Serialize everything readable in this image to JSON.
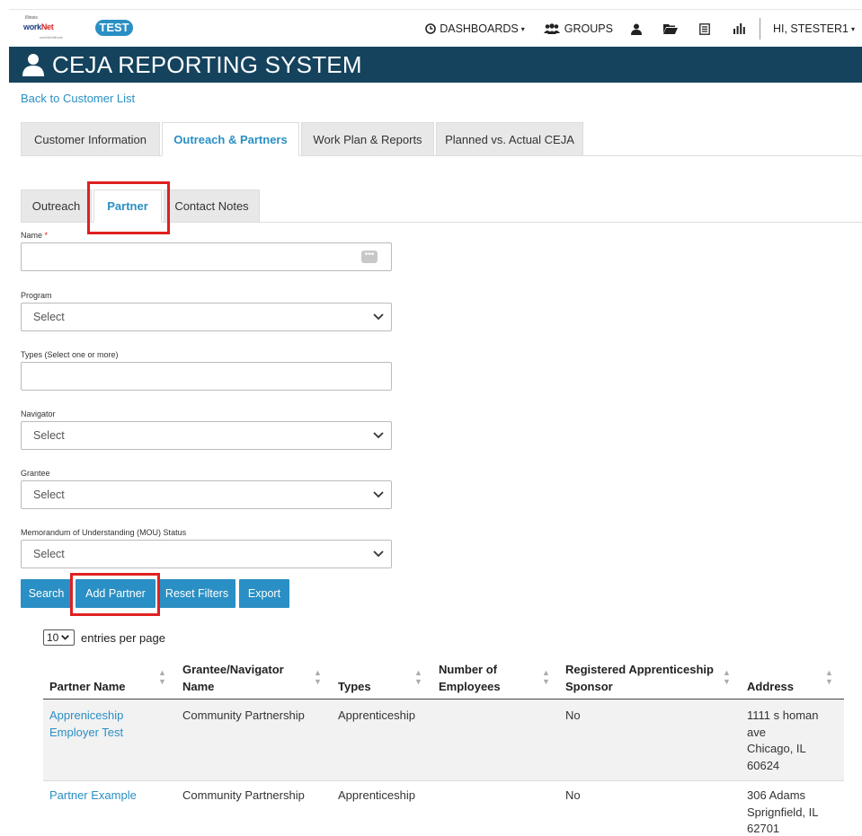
{
  "header": {
    "logo_top": "Illinois",
    "logo_main_a": "work",
    "logo_main_b": "Net",
    "logo_sub": "workNetIllinois",
    "env_badge": "TEST",
    "nav": {
      "dashboards": "DASHBOARDS",
      "groups": "GROUPS",
      "user_greeting": "HI, STESTER1"
    }
  },
  "title_bar": {
    "title": "CEJA REPORTING SYSTEM"
  },
  "back_link": "Back to Customer List",
  "primary_tabs": [
    {
      "label": "Customer Information"
    },
    {
      "label": "Outreach & Partners",
      "active": true
    },
    {
      "label": "Work Plan & Reports"
    },
    {
      "label": "Planned vs. Actual CEJA"
    }
  ],
  "secondary_tabs": [
    {
      "label": "Outreach"
    },
    {
      "label": "Partner",
      "active": true
    },
    {
      "label": "Contact Notes"
    }
  ],
  "form": {
    "name": {
      "label": "Name",
      "required_mark": "*",
      "value": "",
      "ellipsis": "•••"
    },
    "program": {
      "label": "Program",
      "value": "Select"
    },
    "types": {
      "label": "Types (Select one or more)",
      "value": ""
    },
    "navigator": {
      "label": "Navigator",
      "value": "Select"
    },
    "grantee": {
      "label": "Grantee",
      "value": "Select"
    },
    "mou_status": {
      "label": "Memorandum of Understanding (MOU) Status",
      "value": "Select"
    }
  },
  "buttons": {
    "search": "Search",
    "add_partner": "Add Partner",
    "reset_filters": "Reset Filters",
    "export": "Export"
  },
  "table": {
    "page_size": "10",
    "entries_label": "entries per page",
    "columns": {
      "partner_name": "Partner Name",
      "grantee_1": "Grantee/Navigator",
      "grantee_2": "Name",
      "types": "Types",
      "employees_1": "Number of",
      "employees_2": "Employees",
      "sponsor_1": "Registered Apprenticeship",
      "sponsor_2": "Sponsor",
      "address": "Address"
    },
    "rows": [
      {
        "name_1": "Appreniceship",
        "name_2": "Employer Test",
        "grantee": "Community Partnership",
        "types": "Apprenticeship",
        "employees": "",
        "sponsor": "No",
        "address_1": "1111 s homan",
        "address_2": "ave",
        "address_3": "Chicago, IL",
        "address_4": "60624"
      },
      {
        "name_1": "Partner Example",
        "grantee": "Community Partnership",
        "types": "Apprenticeship",
        "employees": "",
        "sponsor": "No",
        "address_1": "306 Adams",
        "address_2": "Sprignfield, IL",
        "address_3": "62701"
      }
    ]
  },
  "colors": {
    "accent": "#2a8fc4",
    "title_bar": "#15435e",
    "highlight": "#e02020"
  }
}
